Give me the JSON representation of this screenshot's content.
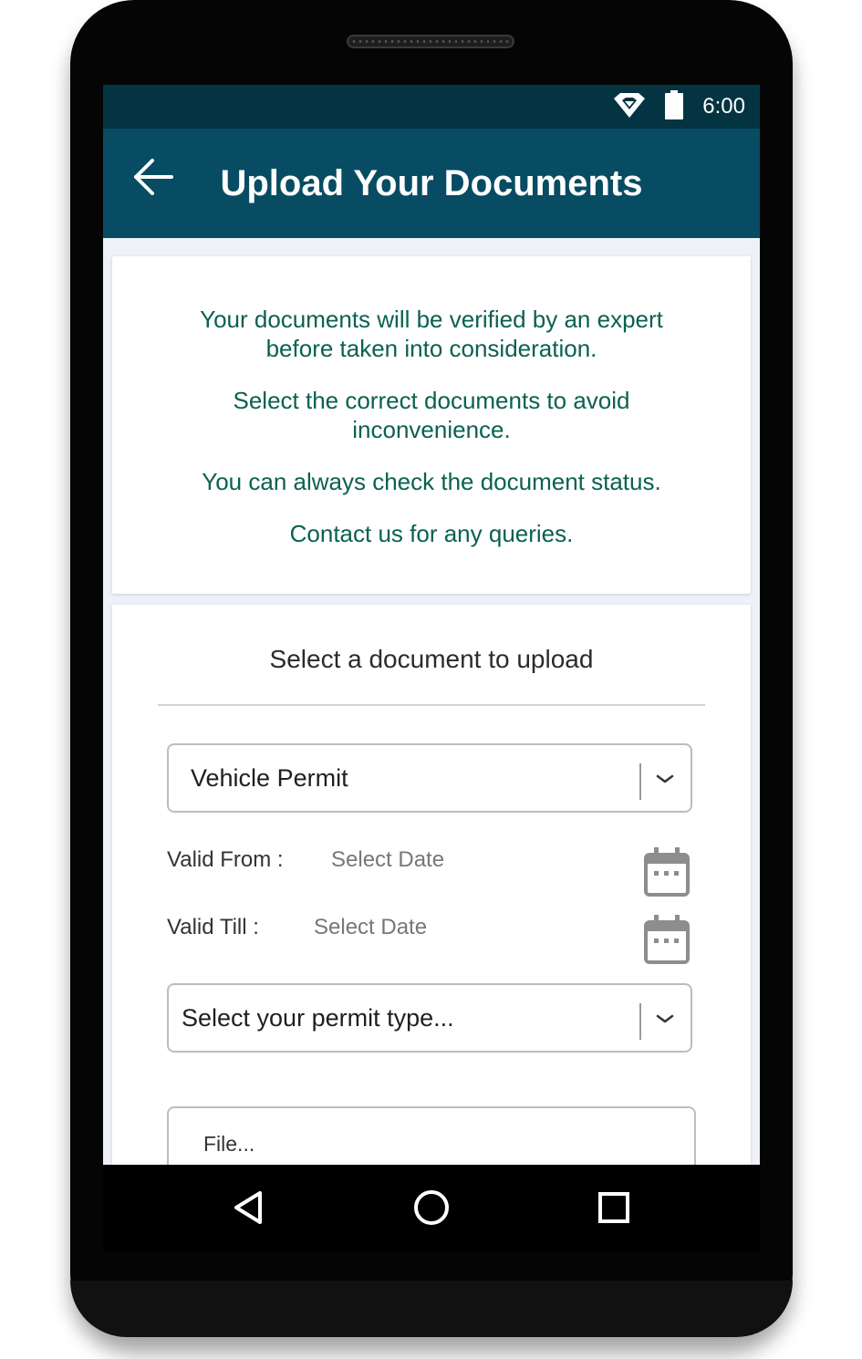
{
  "status_bar": {
    "time": "6:00",
    "icons": [
      "wifi-icon",
      "battery-icon"
    ]
  },
  "app_bar": {
    "title": "Upload Your Documents",
    "back_icon": "arrow-left-icon"
  },
  "info_card": {
    "lines": [
      "Your documents will be verified by an expert",
      "before taken into consideration.",
      "Select the correct documents to avoid",
      "inconvenience.",
      "You can always check the document status.",
      "Contact us for any queries."
    ]
  },
  "form": {
    "heading": "Select a document to upload",
    "document_select": {
      "value": "Vehicle Permit"
    },
    "valid_from": {
      "label": "Valid From :",
      "value": "Select Date"
    },
    "valid_till": {
      "label": "Valid Till :",
      "value": "Select Date"
    },
    "permit_type_select": {
      "value": "Select your permit type..."
    },
    "file_input": {
      "label": "File..."
    }
  },
  "nav_bar": {
    "icons": [
      "back-triangle-icon",
      "home-circle-icon",
      "recents-square-icon"
    ]
  },
  "colors": {
    "status_bar": "#043441",
    "app_bar": "#074c63",
    "info_text": "#0a6150",
    "background": "#eef1f7"
  }
}
